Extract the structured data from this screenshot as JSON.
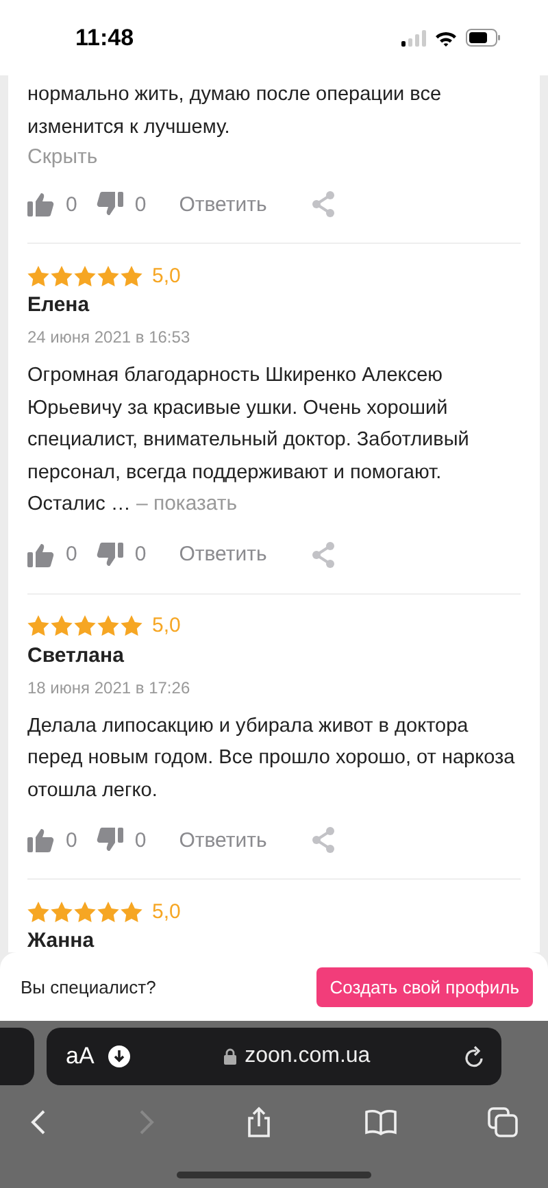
{
  "status_bar": {
    "time": "11:48"
  },
  "reviews": [
    {
      "text": "нормально жить, думаю после операции все изменится к лучшему.",
      "expand_link": "Скрыть",
      "likes": "0",
      "dislikes": "0",
      "reply": "Ответить"
    },
    {
      "stars": 5,
      "rating": "5,0",
      "name": "Елена",
      "date": "24 июня 2021 в 16:53",
      "text": "Огромная благодарность Шкиренко Алексею Юрьевичу за красивые ушки. Очень хороший специалист, внимательный доктор. Заботливый персонал, всегда поддерживают и помогают. Осталис …",
      "expand_link": "– показать",
      "likes": "0",
      "dislikes": "0",
      "reply": "Ответить"
    },
    {
      "stars": 5,
      "rating": "5,0",
      "name": "Светлана",
      "date": "18 июня 2021 в 17:26",
      "text": "Делала липосакцию и убирала живот в доктора перед новым годом. Все прошло хорошо, от наркоза отошла легко.",
      "likes": "0",
      "dislikes": "0",
      "reply": "Ответить"
    },
    {
      "stars": 5,
      "rating": "5,0",
      "name": "Жанна"
    }
  ],
  "banner": {
    "question": "Вы специалист?",
    "button": "Создать свой профиль"
  },
  "browser": {
    "text_size": "aA",
    "url": "zoon.com.ua"
  }
}
